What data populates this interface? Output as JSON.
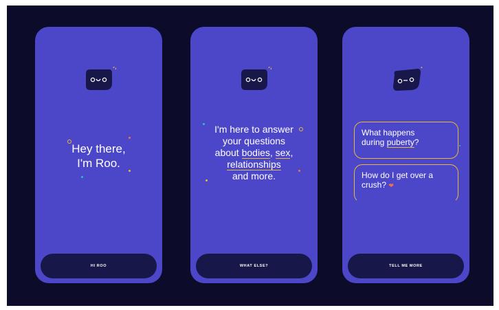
{
  "screens": [
    {
      "headline": [
        "Hey there,",
        "I'm Roo."
      ],
      "button_label": "HI ROO"
    },
    {
      "headline_parts": {
        "line1": "I'm here to answer",
        "line2": "your questions",
        "line3_pre": "about ",
        "link_bodies": "bodies",
        "comma1": ", ",
        "link_sex": "sex",
        "comma2": ",",
        "link_relationships": "relationships",
        "line5": "and more."
      },
      "button_label": "WHAT ELSE?"
    },
    {
      "bubble1_pre": "What happens",
      "bubble1_mid": "during ",
      "bubble1_link": "puberty",
      "bubble1_post": "?",
      "bubble2_text": "How do I get over a crush?",
      "button_label": "TELL ME MORE"
    }
  ],
  "colors": {
    "background": "#0c0c2a",
    "card": "#4c47c9",
    "button": "#17174a",
    "accent_yellow": "#e9b93a",
    "accent_orange": "#f3714f"
  },
  "icons": [
    "roo-mascot-icon",
    "heart-icon"
  ]
}
